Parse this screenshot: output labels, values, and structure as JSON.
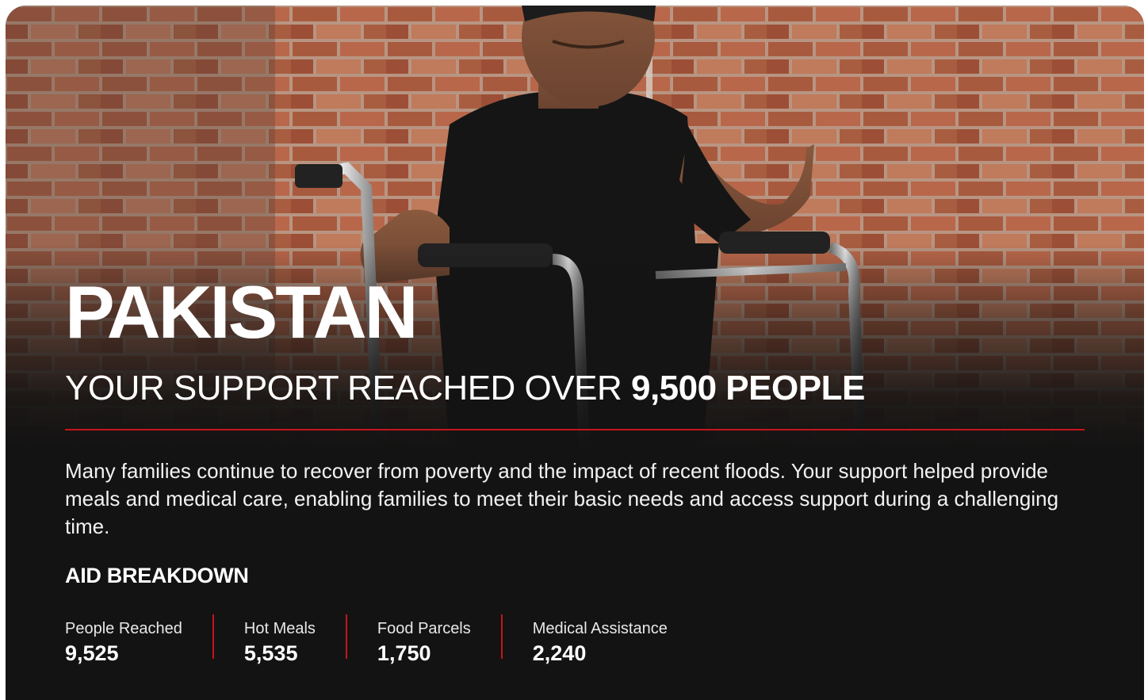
{
  "hero": {
    "title": "PAKISTAN",
    "subtitle_prefix": "YOUR SUPPORT REACHED OVER ",
    "subtitle_highlight": "9,500 PEOPLE",
    "image_subject": "man in wheelchair in front of brick wall"
  },
  "description": "Many families continue to recover from poverty and the impact of recent floods. Your support helped provide meals and medical care, enabling families to meet their basic needs and access support during a challenging time.",
  "aid_breakdown": {
    "heading": "AID BREAKDOWN",
    "stats": [
      {
        "label": "People Reached",
        "value": "9,525"
      },
      {
        "label": "Hot Meals",
        "value": "5,535"
      },
      {
        "label": "Food Parcels",
        "value": "1,750"
      },
      {
        "label": "Medical Assistance",
        "value": "2,240"
      }
    ]
  },
  "colors": {
    "accent": "#c7141a",
    "background": "#131313",
    "text": "#ffffff",
    "brick": "#a0543a"
  }
}
